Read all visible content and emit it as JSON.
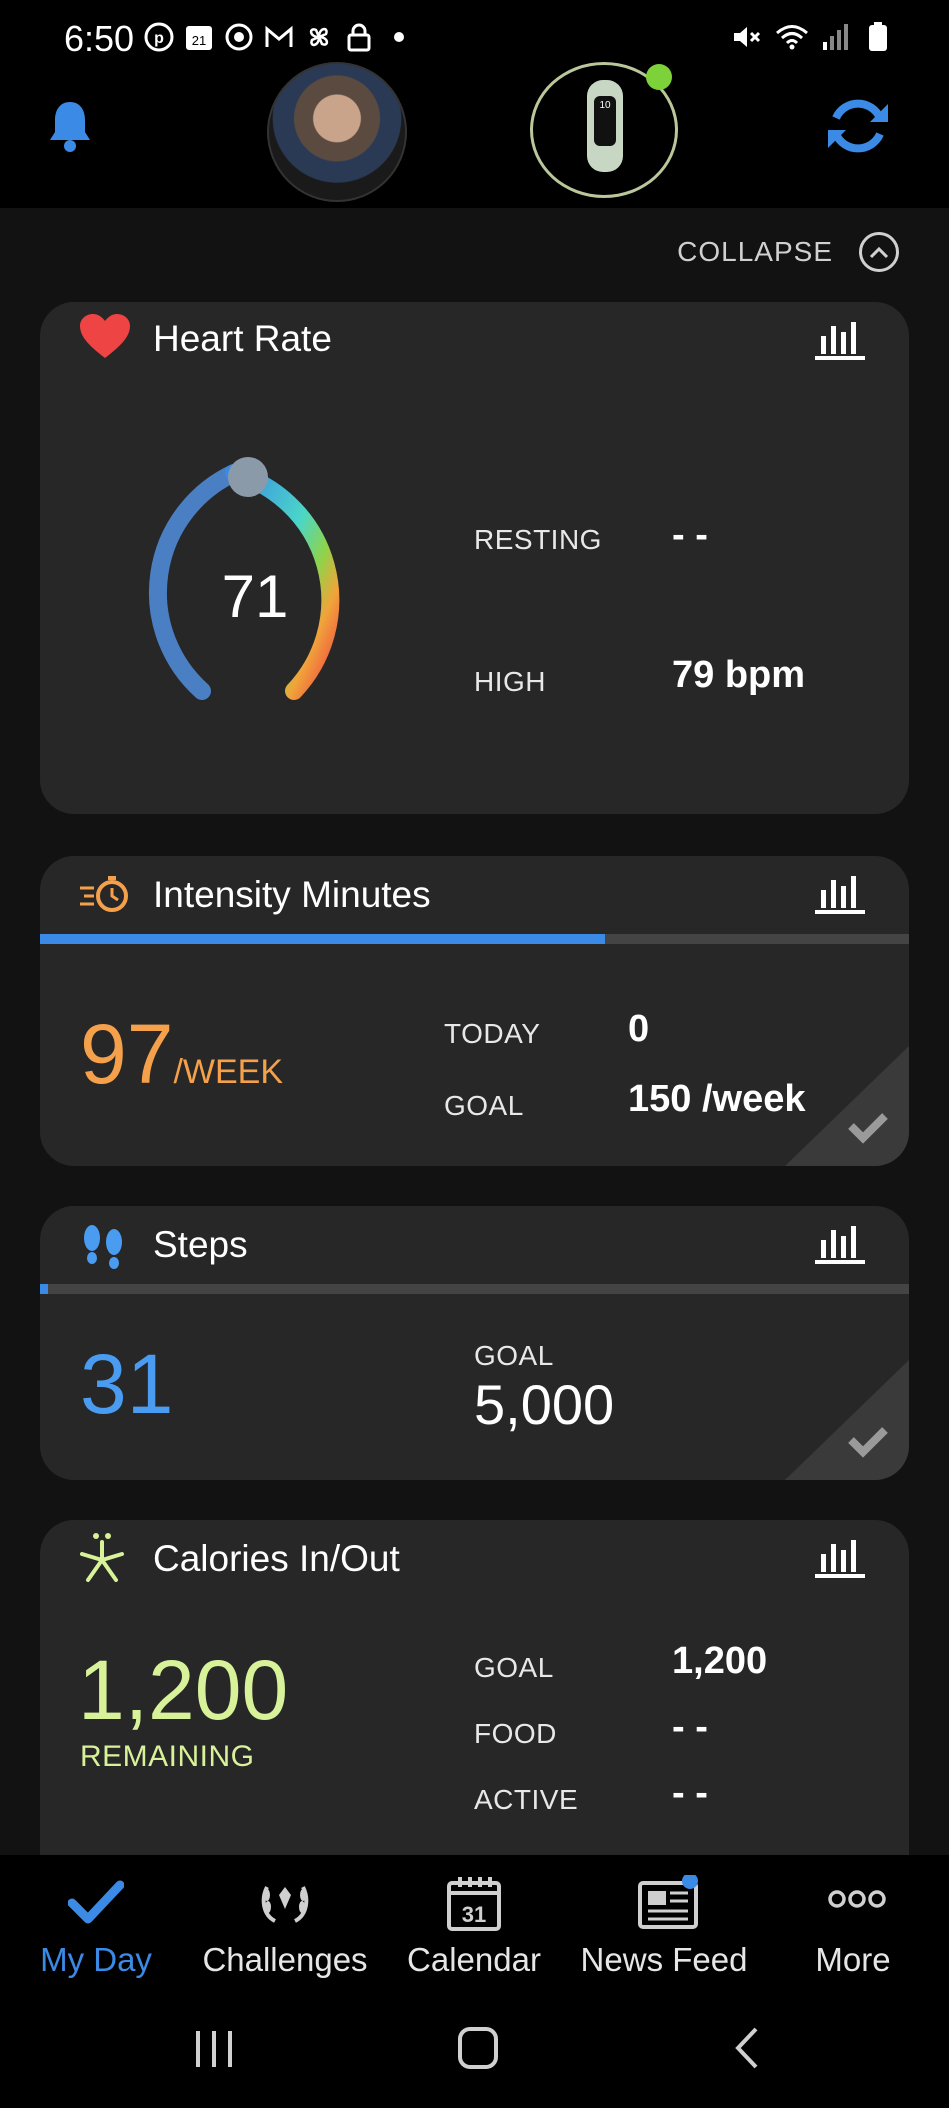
{
  "status_bar": {
    "time": "6:50",
    "left_icons": [
      "pinterest-icon",
      "calendar-icon",
      "target-icon",
      "gmail-icon",
      "pinwheel-icon",
      "lock-icon",
      "dot-icon"
    ],
    "calendar_day": "21",
    "right_icons": [
      "mute-icon",
      "wifi-icon",
      "signal-icon",
      "battery-icon"
    ]
  },
  "header": {
    "bell_icon": "bell-icon",
    "sync_icon": "sync-icon",
    "accent": "#3b8ae6",
    "device_status_color": "#7dd23a",
    "device_time": "10"
  },
  "collapse": {
    "label": "COLLAPSE"
  },
  "heart_rate": {
    "title": "Heart Rate",
    "current": "71",
    "resting_label": "RESTING",
    "resting_value": "- -",
    "high_label": "HIGH",
    "high_value": "79 bpm",
    "accent": "#ef4444"
  },
  "intensity": {
    "title": "Intensity Minutes",
    "weekly_value": "97",
    "weekly_unit": "/WEEK",
    "today_label": "TODAY",
    "today_value": "0",
    "goal_label": "GOAL",
    "goal_value": "150 /week",
    "progress": 0.65,
    "accent": "#f5a04a"
  },
  "steps": {
    "title": "Steps",
    "value": "31",
    "goal_label": "GOAL",
    "goal_value": "5,000",
    "progress": 0.006,
    "accent": "#4a9cf0"
  },
  "calories": {
    "title": "Calories In/Out",
    "remaining_value": "1,200",
    "remaining_label": "REMAINING",
    "goal_label": "GOAL",
    "goal_value": "1,200",
    "food_label": "FOOD",
    "food_value": "- -",
    "active_label": "ACTIVE",
    "active_value": "- -",
    "accent": "#d8f29a"
  },
  "bottom_nav": {
    "items": [
      {
        "label": "My Day",
        "icon": "checkmark-icon",
        "active": true
      },
      {
        "label": "Challenges",
        "icon": "laurel-icon",
        "active": false
      },
      {
        "label": "Calendar",
        "icon": "calendar-icon",
        "active": false
      },
      {
        "label": "News Feed",
        "icon": "newspaper-icon",
        "active": false
      },
      {
        "label": "More",
        "icon": "more-dots-icon",
        "active": false
      }
    ],
    "calendar_day": "31"
  },
  "system_nav": [
    "recent-apps-icon",
    "home-icon",
    "back-icon"
  ]
}
